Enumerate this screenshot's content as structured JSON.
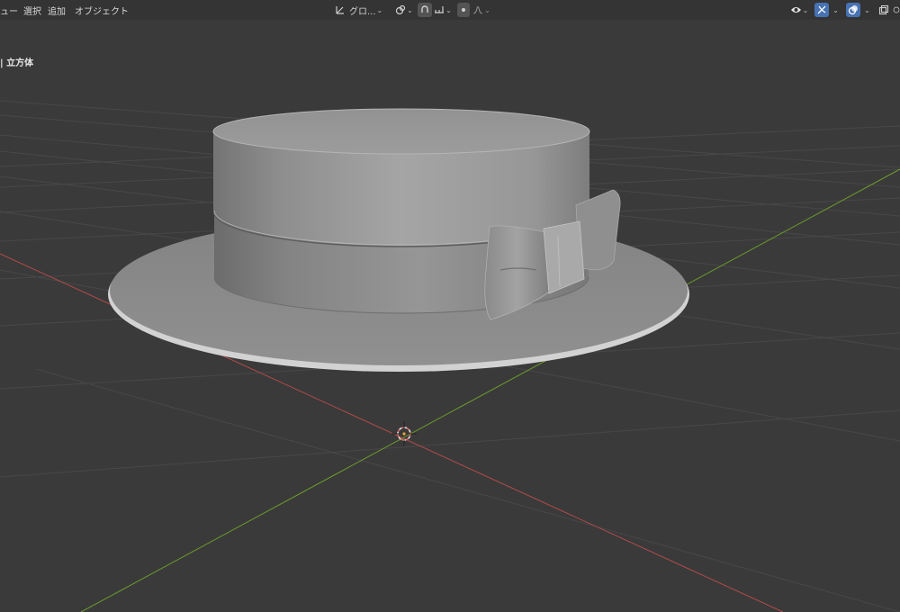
{
  "header": {
    "menus": [
      "ュー",
      "選択",
      "追加",
      "オブジェクト"
    ],
    "orientation_label": "グロ...",
    "orientation_icon": "transform-orientation-icon",
    "pivot_icon": "pivot-point-icon",
    "snap_icon": "snap-icon",
    "snap_target_icon": "snap-increment-icon",
    "proportional_icon": "proportional-editing-icon",
    "falloff_icon": "falloff-curve-icon",
    "visibility_icon": "eye-visibility-icon",
    "gizmo_icon": "gizmo-icon",
    "overlay_icon": "overlay-icon",
    "xray_icon": "xray-icon"
  },
  "viewport": {
    "object_label": "| 立方体",
    "selected_object": "hat",
    "background_color": "#3a3a3a",
    "x_axis_color": "#b34a4a",
    "y_axis_color": "#6a9a2c",
    "accent_color": "#4772b3"
  }
}
